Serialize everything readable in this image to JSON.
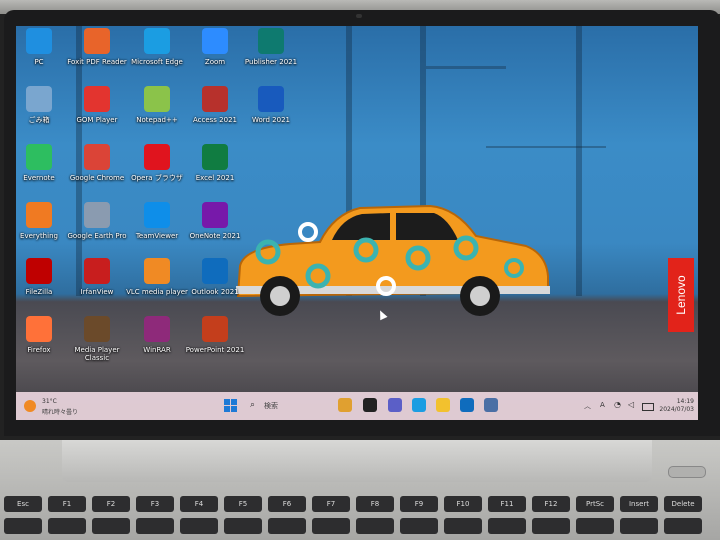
{
  "desktop": {
    "icons": [
      {
        "label": "PC",
        "icon": "pc-icon",
        "color": "#1f8fe0"
      },
      {
        "label": "Foxit PDF Reader",
        "icon": "foxit-pdf-icon",
        "color": "#e8642a"
      },
      {
        "label": "Microsoft Edge",
        "icon": "edge-icon",
        "color": "#1b9de2"
      },
      {
        "label": "Zoom",
        "icon": "zoom-icon",
        "color": "#2d8cff"
      },
      {
        "label": "Publisher 2021",
        "icon": "publisher-icon",
        "color": "#0e7a6f"
      },
      {
        "label": "ごみ箱",
        "icon": "recycle-bin-icon",
        "color": "#7aa6cf"
      },
      {
        "label": "GOM Player",
        "icon": "gom-player-icon",
        "color": "#e3342f"
      },
      {
        "label": "Notepad++",
        "icon": "notepadpp-icon",
        "color": "#8bc34a"
      },
      {
        "label": "Access 2021",
        "icon": "access-icon",
        "color": "#b7312c"
      },
      {
        "label": "Word 2021",
        "icon": "word-icon",
        "color": "#185abd"
      },
      {
        "label": "Evernote",
        "icon": "evernote-icon",
        "color": "#2dbe60"
      },
      {
        "label": "Google Chrome",
        "icon": "chrome-icon",
        "color": "#db4437"
      },
      {
        "label": "Opera ブラウザ",
        "icon": "opera-icon",
        "color": "#e0141e"
      },
      {
        "label": "Excel 2021",
        "icon": "excel-icon",
        "color": "#107c41"
      },
      {
        "label": "Everything",
        "icon": "everything-icon",
        "color": "#f07a22"
      },
      {
        "label": "Google Earth Pro",
        "icon": "google-earth-icon",
        "color": "#8a9bb0"
      },
      {
        "label": "TeamViewer",
        "icon": "teamviewer-icon",
        "color": "#0e8ee9"
      },
      {
        "label": "OneNote 2021",
        "icon": "onenote-icon",
        "color": "#7719aa"
      },
      {
        "label": "FileZilla",
        "icon": "filezilla-icon",
        "color": "#bf0000"
      },
      {
        "label": "IrfanView",
        "icon": "irfanview-icon",
        "color": "#c81e1e"
      },
      {
        "label": "VLC media player",
        "icon": "vlc-icon",
        "color": "#f08a24"
      },
      {
        "label": "Outlook 2021",
        "icon": "outlook-icon",
        "color": "#0f6cbd"
      },
      {
        "label": "Firefox",
        "icon": "firefox-icon",
        "color": "#ff7139"
      },
      {
        "label": "Media Player Classic",
        "icon": "media-player-classic-icon",
        "color": "#6b4a2a"
      },
      {
        "label": "WinRAR",
        "icon": "winrar-icon",
        "color": "#8e2a7a"
      },
      {
        "label": "PowerPoint 2021",
        "icon": "powerpoint-icon",
        "color": "#c43e1c"
      }
    ]
  },
  "taskbar": {
    "weather_temp": "31°C",
    "weather_condition": "晴れ時々曇り",
    "search_label": "検索",
    "apps": [
      {
        "icon": "chart-app-icon",
        "color": "#e0a030"
      },
      {
        "icon": "l-app-icon",
        "color": "#222222"
      },
      {
        "icon": "chat-icon",
        "color": "#5b5fc7"
      },
      {
        "icon": "edge-taskbar-icon",
        "color": "#1b9de2"
      },
      {
        "icon": "file-explorer-icon",
        "color": "#f2c12e"
      },
      {
        "icon": "mail-icon",
        "color": "#0f6cbd"
      },
      {
        "icon": "settings-icon",
        "color": "#4a6fa5"
      }
    ],
    "ime_mode": "A",
    "clock_time": "14:19",
    "clock_date": "2024/07/03"
  },
  "branding": {
    "tag": "Lenovo"
  },
  "keyboard": {
    "keys": [
      "Esc",
      "F1",
      "F2",
      "F3",
      "F4",
      "F5",
      "F6",
      "F7",
      "F8",
      "F9",
      "F10",
      "F11",
      "F12",
      "PrtSc",
      "Insert",
      "Delete"
    ]
  }
}
